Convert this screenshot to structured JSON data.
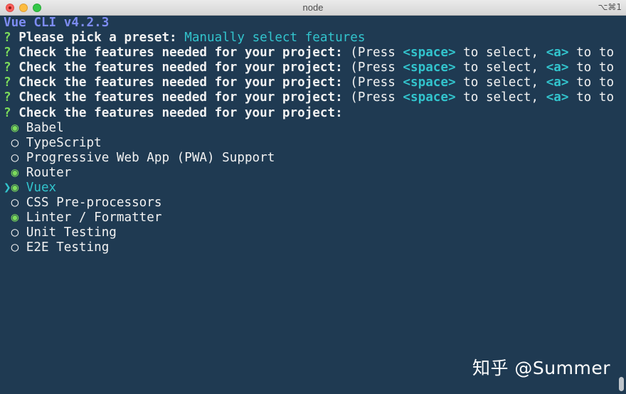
{
  "window": {
    "title": "node",
    "shortcut": "⌥⌘1"
  },
  "terminal": {
    "header": "Vue CLI v4.2.3",
    "q_mark": "?",
    "preset_prompt": "Please pick a preset:",
    "preset_answer": "Manually select features",
    "features_prompt": "Check the features needed for your project:",
    "hint_open": "(Press",
    "hint_space": "<space>",
    "hint_to_select": "to select,",
    "hint_a": "<a>",
    "hint_to": "to to",
    "repeated_prompt_count_label": "",
    "options": [
      {
        "label": "Babel",
        "selected": true
      },
      {
        "label": "TypeScript",
        "selected": false
      },
      {
        "label": "Progressive Web App (PWA) Support",
        "selected": false
      },
      {
        "label": "Router",
        "selected": true
      },
      {
        "label": "Vuex",
        "selected": true
      },
      {
        "label": "CSS Pre-processors",
        "selected": false
      },
      {
        "label": "Linter / Formatter",
        "selected": true
      },
      {
        "label": "Unit Testing",
        "selected": false
      },
      {
        "label": "E2E Testing",
        "selected": false
      }
    ],
    "active_index": 4,
    "cursor_glyph": "❯",
    "selected_glyph": "◉",
    "unselected_glyph": "○"
  },
  "watermark": "知乎 @Summer",
  "colors": {
    "background": "#1f3a52",
    "prompt_green": "#7cdc5b",
    "answer_cyan": "#32c4cd",
    "header_blue": "#7d8cf2",
    "text": "#f2f2f2"
  }
}
